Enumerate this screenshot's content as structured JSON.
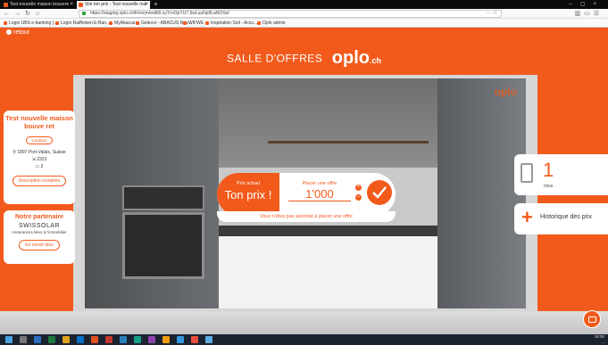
{
  "browser": {
    "tabs": [
      {
        "label": "Test nouvelle maison bouvere"
      },
      {
        "label": "Voir ton prix - Test nouvelle mai"
      }
    ],
    "url": "https://staging.oplo.ch/fr/room/edit0t.xyYrnOpYU7.5wLuuNp9LaNOSel",
    "bookmarks": [
      "Login UBS e-banking (...",
      "Login Raiffeisen E-Ban...",
      "MyAbacus",
      "Gelecor - ABACUS Res...",
      "WIFWE",
      "Inspiration Soil - Accu...",
      "Oplo admin"
    ]
  },
  "page": {
    "back_label": "retour",
    "header_title": "SALLE D'OFFRES",
    "logo_text": "oplo",
    "logo_suffix": ".ch"
  },
  "property": {
    "title": "Test nouvelle maison bouve ret",
    "tag": "Location",
    "location": "1897 Port-Valais, Suisse",
    "area": "2323",
    "rooms": "2",
    "details_button": "Description complète"
  },
  "partner": {
    "heading": "Notre partenaire",
    "name": "SWISSOLAR",
    "subtitle": "Assurances liées à l'immobilier",
    "button": "En savoir plus"
  },
  "offer": {
    "current_label": "Prix actuel",
    "current_value": "Ton prix !",
    "place_label": "Placer une offre",
    "place_value": "1'000",
    "warning": "Vous n'êtes pas autorisé à placer une offre"
  },
  "stats": {
    "count": "1",
    "count_label": "mise",
    "history_label": "Historique des prix"
  },
  "taskbar": {
    "time": "16:00",
    "date": "..."
  }
}
